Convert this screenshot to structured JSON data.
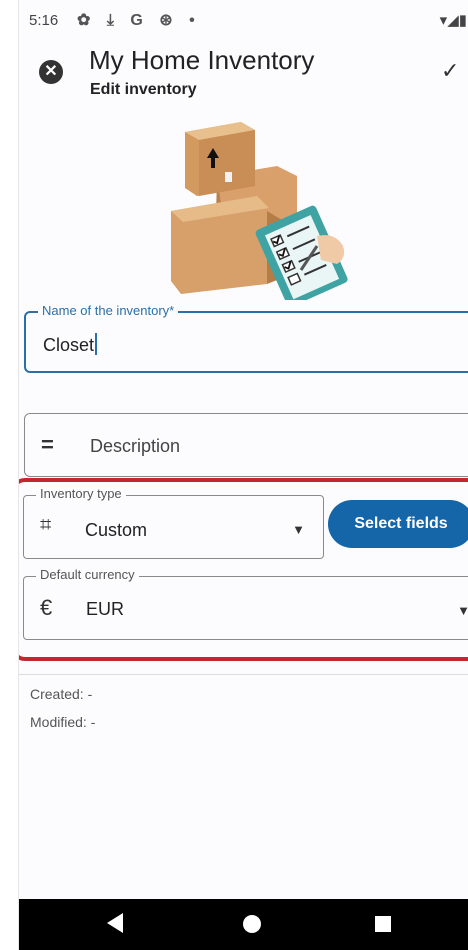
{
  "status_bar": {
    "time": "5:16",
    "icons": [
      "gear-icon",
      "download-icon",
      "google-icon",
      "at-icon",
      "dot-icon"
    ],
    "icons_text": "✿ ⤓ G ⊛ •",
    "right_text": "▾◢▮"
  },
  "header": {
    "title": "My Home Inventory",
    "subtitle": "Edit inventory",
    "close_icon": "✕",
    "save_icon": "✓"
  },
  "form": {
    "name": {
      "label": "Name of the inventory*",
      "value": "Closet"
    },
    "description": {
      "placeholder": "Description",
      "icon": "="
    },
    "inventory_type": {
      "label": "Inventory type",
      "value": "Custom",
      "icon": "⌗"
    },
    "select_fields_label": "Select fields",
    "default_currency": {
      "label": "Default currency",
      "value": "EUR",
      "icon": "€"
    },
    "dropdown_icon": "▼"
  },
  "meta": {
    "created": "Created: -",
    "modified": "Modified: -"
  },
  "colors": {
    "accent": "#2b6fa8",
    "button": "#1565a9",
    "highlight": "#c3262c"
  }
}
